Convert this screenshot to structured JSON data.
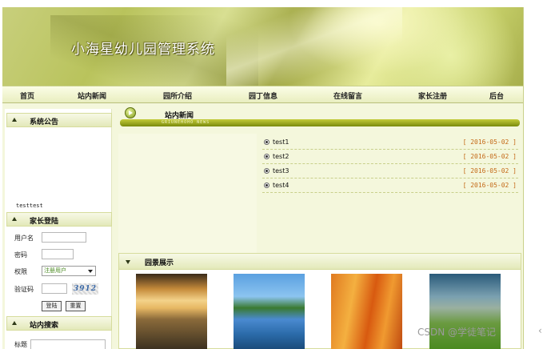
{
  "site": {
    "title": "小海星幼儿园管理系统"
  },
  "nav": {
    "items": [
      "首页",
      "站内新闻",
      "园所介绍",
      "园丁信息",
      "在线留言",
      "家长注册",
      "后台"
    ]
  },
  "sidebar": {
    "notice": {
      "heading": "系统公告",
      "text": "testtest"
    },
    "login": {
      "heading": "家长登陆",
      "username_label": "用户名",
      "password_label": "密码",
      "role_label": "权限",
      "role_value": "注册用户",
      "captcha_label": "验证码",
      "captcha_code": "3912",
      "login_button": "登陆",
      "reset_button": "重置"
    },
    "search": {
      "heading": "站内搜索",
      "title_label": "标题"
    }
  },
  "news": {
    "heading": "站内新闻",
    "subtitle": "GRIUNEHOHO NEWS",
    "items": [
      {
        "title": "test1",
        "date": "[ 2016-05-02 ]"
      },
      {
        "title": "test2",
        "date": "[ 2016-05-02 ]"
      },
      {
        "title": "test3",
        "date": "[ 2016-05-02 ]"
      },
      {
        "title": "test4",
        "date": "[ 2016-05-02 ]"
      }
    ]
  },
  "scenery": {
    "heading": "园景展示",
    "photos": [
      "sunset-bridge-photo",
      "castle-lake-photo",
      "autumn-forest-photo",
      "field-house-photo"
    ]
  },
  "watermark": "CSDN @学徒笔记"
}
